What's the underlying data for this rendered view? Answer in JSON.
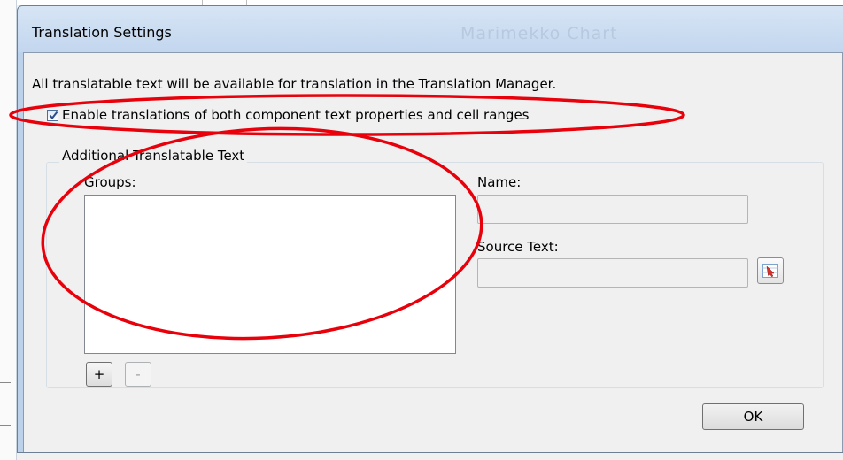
{
  "dialog": {
    "title": "Translation Settings",
    "background_title": "Marimekko Chart",
    "description": "All translatable text will be available for translation in the Translation Manager.",
    "enable_checkbox": {
      "label": "Enable translations of both component text properties and cell ranges",
      "checked": true
    },
    "group": {
      "legend": "Additional Translatable Text",
      "groups_label": "Groups:",
      "name_label": "Name:",
      "name_value": "",
      "source_text_label": "Source Text:",
      "source_text_value": "",
      "add_button": "+",
      "remove_button": "-"
    },
    "ok_button": "OK"
  },
  "annotations": {
    "color": "#e8000b"
  },
  "icons": {
    "cell_picker": "cell-picker-icon",
    "check": "checkmark-icon"
  }
}
